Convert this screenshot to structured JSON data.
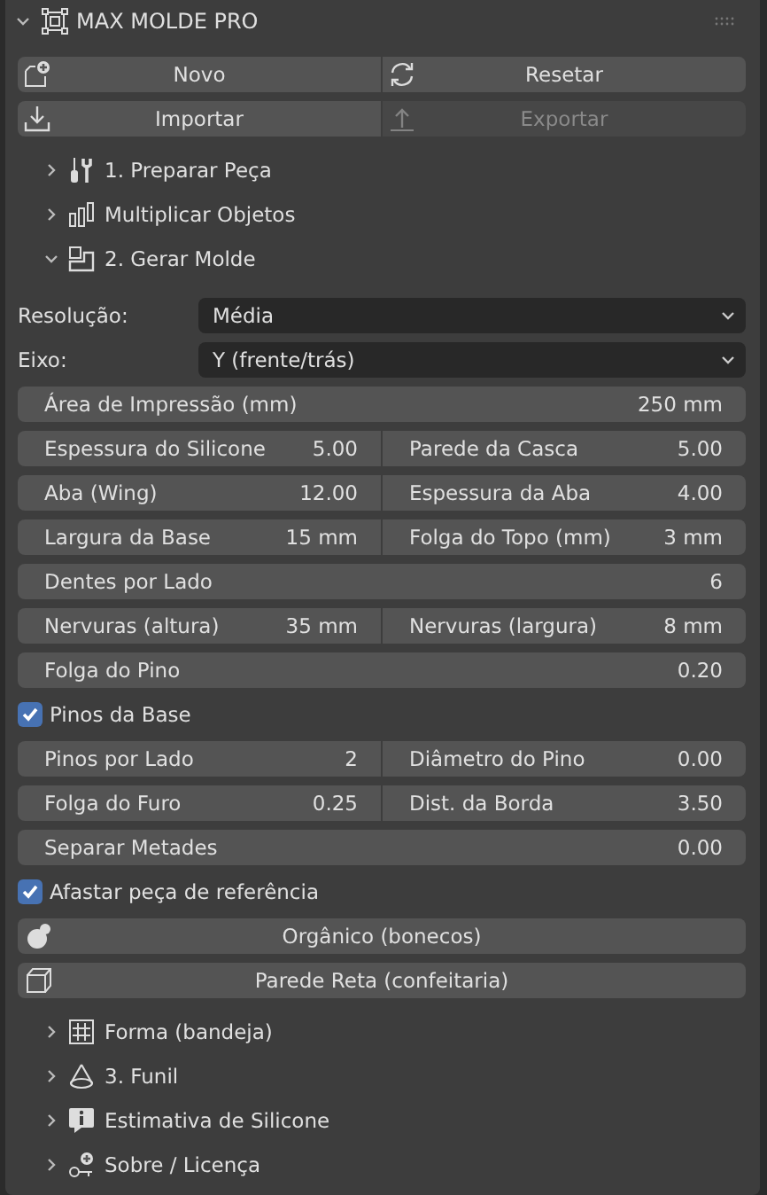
{
  "panel": {
    "title": "MAX MOLDE PRO",
    "expanded": true
  },
  "toolbar": [
    {
      "label": "Novo",
      "disabled": false
    },
    {
      "label": "Resetar",
      "disabled": false
    },
    {
      "label": "Importar",
      "disabled": false
    },
    {
      "label": "Exportar",
      "disabled": true
    }
  ],
  "subpanels": [
    {
      "label": "1. Preparar Peça",
      "expanded": false
    },
    {
      "label": "Multiplicar Objetos",
      "expanded": false
    },
    {
      "label": "2. Gerar Molde",
      "expanded": true,
      "controls": [
        {
          "kind": "dropdown",
          "label": "Resolução:",
          "value": "Média"
        },
        {
          "kind": "dropdown",
          "label": "Eixo:",
          "value": "Y (frente/trás)"
        },
        {
          "kind": "field",
          "label": "Área de Impressão (mm)",
          "value": "250 mm"
        },
        {
          "kind": "pair",
          "fields": [
            {
              "label": "Espessura do Silicone",
              "value": "5.00"
            },
            {
              "label": "Parede da Casca",
              "value": "5.00"
            }
          ]
        },
        {
          "kind": "pair",
          "fields": [
            {
              "label": "Aba (Wing)",
              "value": "12.00"
            },
            {
              "label": "Espessura da Aba",
              "value": "4.00"
            }
          ]
        },
        {
          "kind": "pair",
          "fields": [
            {
              "label": "Largura da Base",
              "value": "15 mm"
            },
            {
              "label": "Folga do Topo (mm)",
              "value": "3 mm"
            }
          ]
        },
        {
          "kind": "field",
          "label": "Dentes por Lado",
          "value": "6"
        },
        {
          "kind": "pair",
          "fields": [
            {
              "label": "Nervuras (altura)",
              "value": "35 mm"
            },
            {
              "label": "Nervuras (largura)",
              "value": "8 mm"
            }
          ]
        },
        {
          "kind": "field",
          "label": "Folga do Pino",
          "value": "0.20"
        },
        {
          "kind": "checkbox",
          "label": "Pinos da Base",
          "checked": true
        },
        {
          "kind": "pair",
          "fields": [
            {
              "label": "Pinos por Lado",
              "value": "2"
            },
            {
              "label": "Diâmetro do Pino",
              "value": "0.00"
            }
          ]
        },
        {
          "kind": "pair",
          "fields": [
            {
              "label": "Folga do Furo",
              "value": "0.25"
            },
            {
              "label": "Dist. da Borda",
              "value": "3.50"
            }
          ]
        },
        {
          "kind": "field",
          "label": "Separar Metades",
          "value": "0.00"
        },
        {
          "kind": "checkbox",
          "label": "Afastar peça de referência",
          "checked": true
        },
        {
          "kind": "button",
          "label": "Orgânico (bonecos)"
        },
        {
          "kind": "button",
          "label": "Parede Reta (confeitaria)"
        }
      ]
    },
    {
      "label": "Forma (bandeja)",
      "expanded": false
    },
    {
      "label": "3. Funil",
      "expanded": false
    },
    {
      "label": "Estimativa de Silicone",
      "expanded": false
    },
    {
      "label": "Sobre / Licença",
      "expanded": false
    }
  ]
}
